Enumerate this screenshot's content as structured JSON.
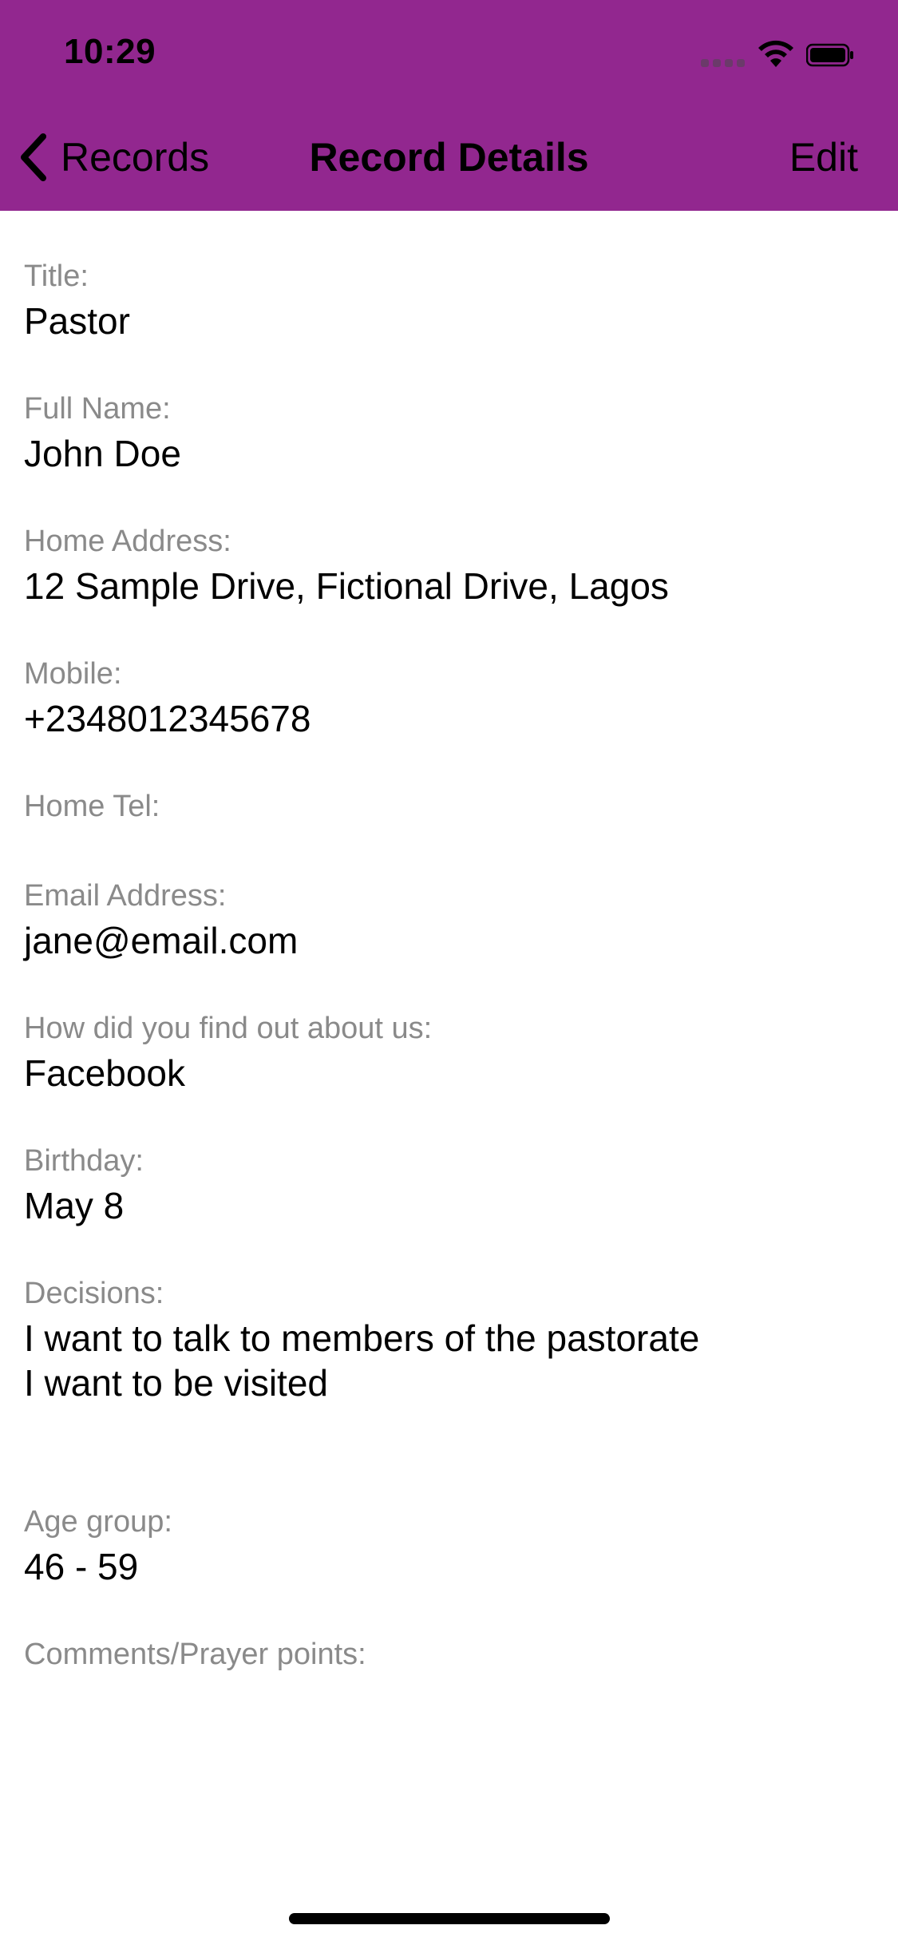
{
  "status_bar": {
    "time": "10:29"
  },
  "nav": {
    "back_label": "Records",
    "title": "Record Details",
    "edit_label": "Edit"
  },
  "colors": {
    "header_bg": "#92278f",
    "label_text": "#8a8a8a",
    "value_text": "#000000"
  },
  "record": {
    "title": {
      "label": "Title:",
      "value": "Pastor"
    },
    "full_name": {
      "label": "Full Name:",
      "value": "John Doe"
    },
    "home_address": {
      "label": "Home Address:",
      "value": "12 Sample Drive, Fictional Drive, Lagos"
    },
    "mobile": {
      "label": "Mobile:",
      "value": "+2348012345678"
    },
    "home_tel": {
      "label": "Home Tel:",
      "value": ""
    },
    "email": {
      "label": "Email Address:",
      "value": "jane@email.com"
    },
    "source": {
      "label": "How did you find out about us:",
      "value": "Facebook"
    },
    "birthday": {
      "label": "Birthday:",
      "value": "May 8"
    },
    "decisions": {
      "label": "Decisions:",
      "value": "I want to talk to members of the pastorate\nI want to be visited"
    },
    "age_group": {
      "label": "Age group:",
      "value": "46 - 59"
    },
    "comments": {
      "label": "Comments/Prayer points:",
      "value": ""
    }
  }
}
